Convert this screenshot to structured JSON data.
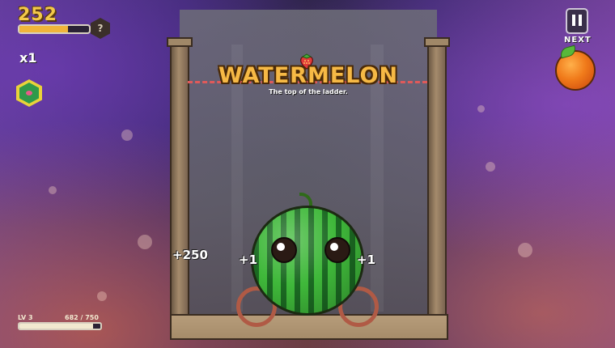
{
  "hud": {
    "score": "252",
    "score_progress": 0.7,
    "help_label": "?",
    "multiplier": "x1",
    "level": "LV 3",
    "xp": "682 / 750",
    "xp_progress": 0.909
  },
  "next": {
    "label": "NEXT",
    "fruit": "orange-icon"
  },
  "banner": {
    "title": "WATERMELON",
    "subtitle": "The top of the ladder.",
    "icon": "strawberry-icon"
  },
  "popups": {
    "left_score": "+250",
    "left_point": "+1",
    "right_point": "+1"
  },
  "colors": {
    "title": "#f6b945",
    "limit_line": "#e05a5a",
    "melon_dark": "#1b6a22",
    "melon_light": "#3fb83a"
  }
}
